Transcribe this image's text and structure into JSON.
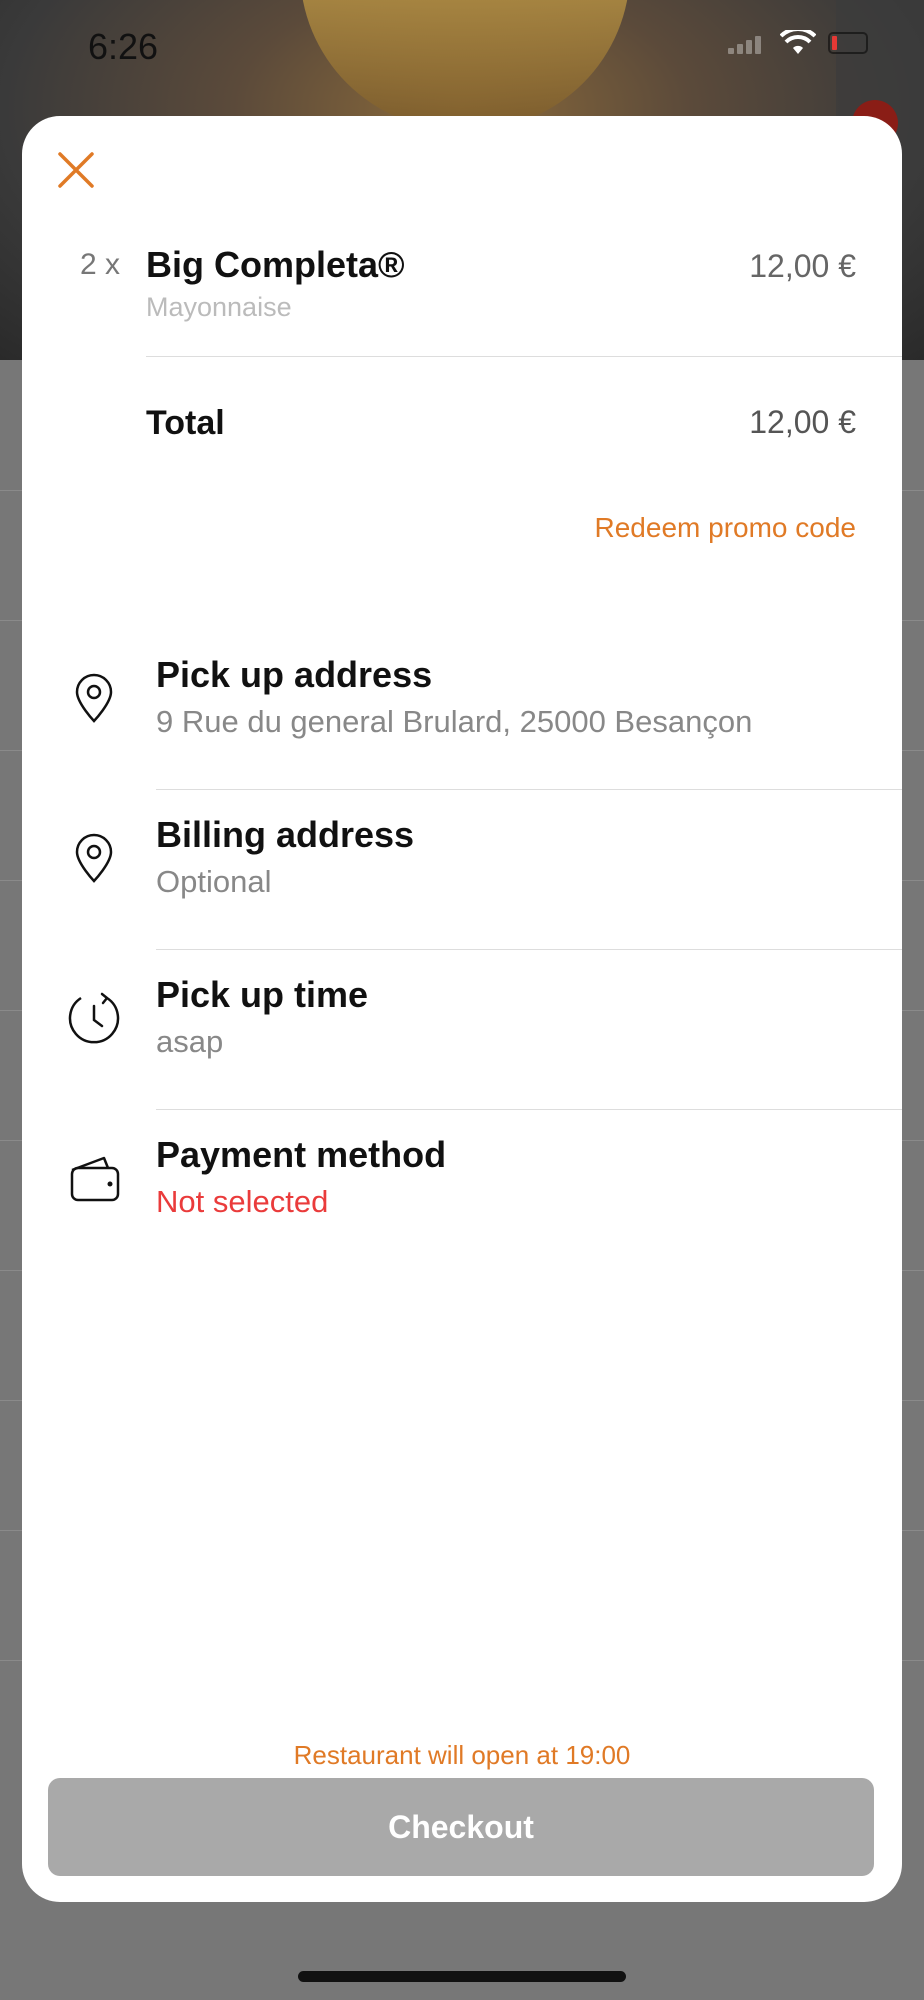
{
  "status_bar": {
    "time": "6:26"
  },
  "cart": {
    "items": [
      {
        "quantity": "2 x",
        "name": "Big Completa®",
        "option": "Mayonnaise",
        "price": "12,00 €"
      }
    ],
    "total_label": "Total",
    "total_value": "12,00 €",
    "promo_label": "Redeem promo code"
  },
  "details": {
    "pickup_address": {
      "title": "Pick up address",
      "value": "9 Rue du general Brulard, 25000 Besançon",
      "icon": "location-pin-icon"
    },
    "billing_address": {
      "title": "Billing address",
      "value": "Optional",
      "icon": "location-pin-icon"
    },
    "pickup_time": {
      "title": "Pick up time",
      "value": "asap",
      "icon": "clock-icon"
    },
    "payment_method": {
      "title": "Payment method",
      "value": "Not selected",
      "icon": "wallet-icon"
    }
  },
  "footer": {
    "notice": "Restaurant will open at 19:00",
    "checkout_label": "Checkout"
  },
  "colors": {
    "accent": "#e07a26",
    "error": "#ea3b3b",
    "button_disabled": "#a9a9a9"
  }
}
